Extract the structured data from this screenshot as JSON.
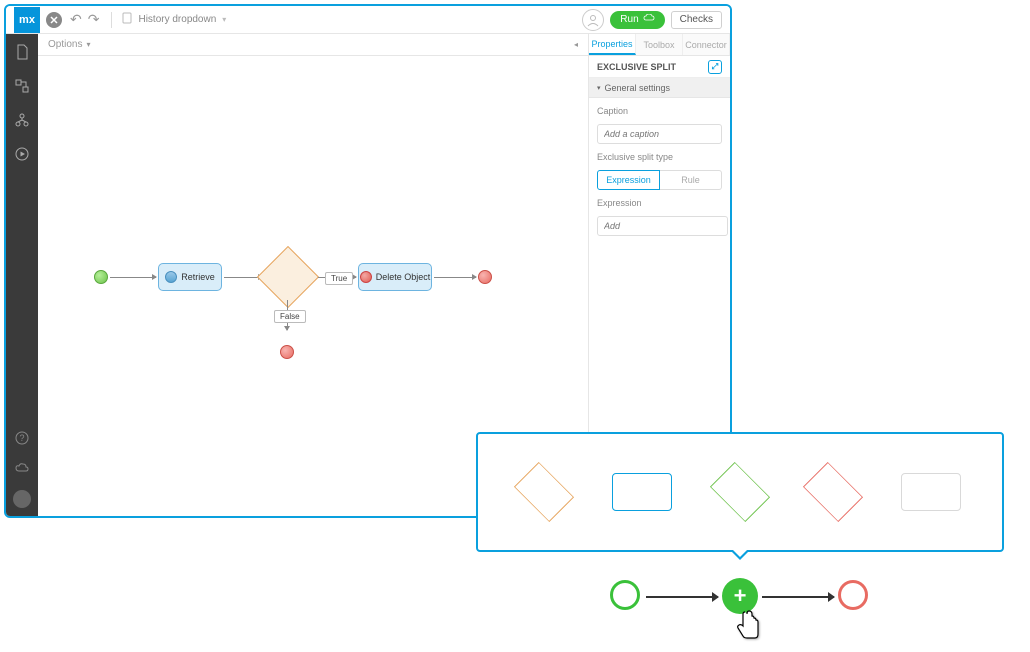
{
  "topbar": {
    "doc_title": "History dropdown",
    "run_label": "Run",
    "checks_label": "Checks"
  },
  "options_bar": {
    "label": "Options"
  },
  "right_panel": {
    "tabs": [
      {
        "label": "Properties",
        "active": true
      },
      {
        "label": "Toolbox",
        "active": false
      },
      {
        "label": "Connector",
        "active": false
      }
    ],
    "header": "EXCLUSIVE SPLIT",
    "section": "General settings",
    "caption_label": "Caption",
    "caption_placeholder": "Add a caption",
    "split_type_label": "Exclusive split type",
    "split_type_options": [
      "Expression",
      "Rule"
    ],
    "split_type_selected": "Expression",
    "expression_label": "Expression",
    "expression_placeholder": "Add"
  },
  "microflow": {
    "retrieve_label": "Retrieve",
    "delete_label": "Delete Object",
    "true_label": "True",
    "false_label": "False"
  },
  "palette": {
    "items": [
      {
        "shape": "diamond",
        "color": "#e6a35a"
      },
      {
        "shape": "rect",
        "color": "#0aa0de"
      },
      {
        "shape": "diamond",
        "color": "#6cc24a"
      },
      {
        "shape": "diamond",
        "color": "#e86b62"
      },
      {
        "shape": "rect",
        "color": "#d9d9d9"
      }
    ]
  }
}
